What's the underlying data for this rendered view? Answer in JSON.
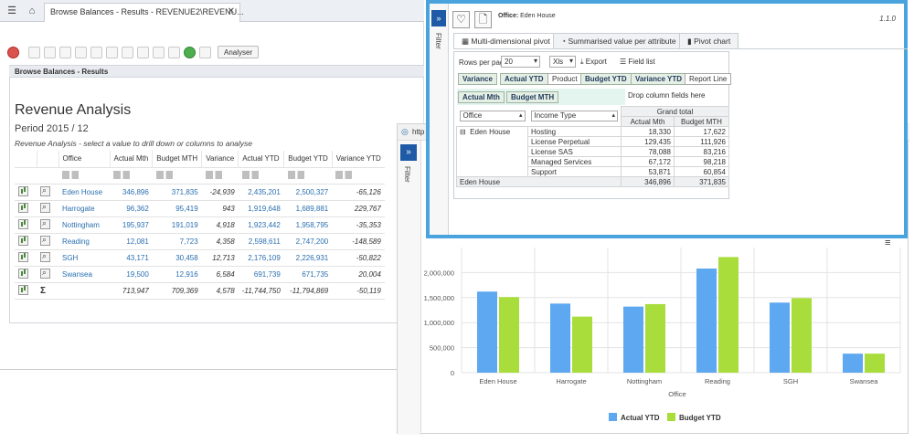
{
  "window1": {
    "tab_title": "Browse Balances - Results - REVENUE2\\REVENU...",
    "analyser_label": "Analyser",
    "section_title": "Browse Balances - Results",
    "report_title": "Revenue Analysis",
    "period": "Period 2015 / 12",
    "subtitle": "Revenue Analysis - select a value to drill down or columns to analyse",
    "columns": [
      "Office",
      "Actual Mth",
      "Budget MTH",
      "Variance",
      "Actual YTD",
      "Budget YTD",
      "Variance YTD"
    ],
    "rows": [
      {
        "office": "Eden House",
        "actual_mth": "346,896",
        "budget_mth": "371,835",
        "variance": "-24,939",
        "actual_ytd": "2,435,201",
        "budget_ytd": "2,500,327",
        "variance_ytd": "-65,126"
      },
      {
        "office": "Harrogate",
        "actual_mth": "96,362",
        "budget_mth": "95,419",
        "variance": "943",
        "actual_ytd": "1,919,648",
        "budget_ytd": "1,689,881",
        "variance_ytd": "229,767"
      },
      {
        "office": "Nottingham",
        "actual_mth": "195,937",
        "budget_mth": "191,019",
        "variance": "4,918",
        "actual_ytd": "1,923,442",
        "budget_ytd": "1,958,795",
        "variance_ytd": "-35,353"
      },
      {
        "office": "Reading",
        "actual_mth": "12,081",
        "budget_mth": "7,723",
        "variance": "4,358",
        "actual_ytd": "2,598,611",
        "budget_ytd": "2,747,200",
        "variance_ytd": "-148,589"
      },
      {
        "office": "SGH",
        "actual_mth": "43,171",
        "budget_mth": "30,458",
        "variance": "12,713",
        "actual_ytd": "2,176,109",
        "budget_ytd": "2,226,931",
        "variance_ytd": "-50,822"
      },
      {
        "office": "Swansea",
        "actual_mth": "19,500",
        "budget_mth": "12,916",
        "variance": "6,584",
        "actual_ytd": "691,739",
        "budget_ytd": "671,735",
        "variance_ytd": "20,004"
      }
    ],
    "totals": {
      "actual_mth": "713,947",
      "budget_mth": "709,369",
      "variance": "4,578",
      "actual_ytd": "-11,744,750",
      "budget_ytd": "-11,794,869",
      "variance_ytd": "-50,119"
    }
  },
  "window2": {
    "url_fragment": "http",
    "filter_label": "Filter"
  },
  "chart_data": {
    "type": "bar",
    "categories": [
      "Eden House",
      "Harrogate",
      "Nottingham",
      "Reading",
      "SGH",
      "Swansea"
    ],
    "series": [
      {
        "name": "Actual YTD",
        "color": "#5da8f0",
        "values": [
          1620000,
          1380000,
          1320000,
          2080000,
          1400000,
          380000
        ]
      },
      {
        "name": "Budget YTD",
        "color": "#a8dd3c",
        "values": [
          1510000,
          1120000,
          1370000,
          2310000,
          1490000,
          380000
        ]
      }
    ],
    "xlabel": "Office",
    "ylabel": "",
    "ylim": [
      0,
      2500000
    ],
    "yticks": [
      0,
      500000,
      1000000,
      1500000,
      2000000
    ],
    "ytick_labels": [
      "0",
      "500,000",
      "1,000,000",
      "1,500,000",
      "2,000,000"
    ],
    "grid": true,
    "legend_position": "bottom"
  },
  "window3": {
    "filter_label": "Filter",
    "office_label": "Office:",
    "office_value": "Eden House",
    "version": "1.1.0",
    "tabs": [
      "Multi-dimensional pivot",
      "Summarised value per attribute",
      "Pivot chart"
    ],
    "rows_per_page_label": "Rows per page",
    "rows_per_page_value": "20",
    "format_value": "Xls",
    "export_label": "Export",
    "field_list_label": "Field list",
    "field_chips": [
      "Variance",
      "Actual YTD",
      "Product",
      "Budget YTD",
      "Variance YTD",
      "Report Line"
    ],
    "value_chips": [
      "Actual Mth",
      "Budget MTH"
    ],
    "drop_column_text": "Drop column fields here",
    "row_selectors": [
      "Office",
      "Income Type"
    ],
    "grand_total_label": "Grand total",
    "value_headers": [
      "Actual Mth",
      "Budget MTH"
    ],
    "office_row": "Eden House",
    "income_rows": [
      {
        "type": "Hosting",
        "actual": "18,330",
        "budget": "17,622"
      },
      {
        "type": "License Perpetual",
        "actual": "129,435",
        "budget": "111,926"
      },
      {
        "type": "License SAS",
        "actual": "78,088",
        "budget": "83,216"
      },
      {
        "type": "Managed Services",
        "actual": "67,172",
        "budget": "98,218"
      },
      {
        "type": "Support",
        "actual": "53,871",
        "budget": "60,854"
      }
    ],
    "total_label": "Eden House",
    "total_actual": "346,896",
    "total_budget": "371,835"
  }
}
